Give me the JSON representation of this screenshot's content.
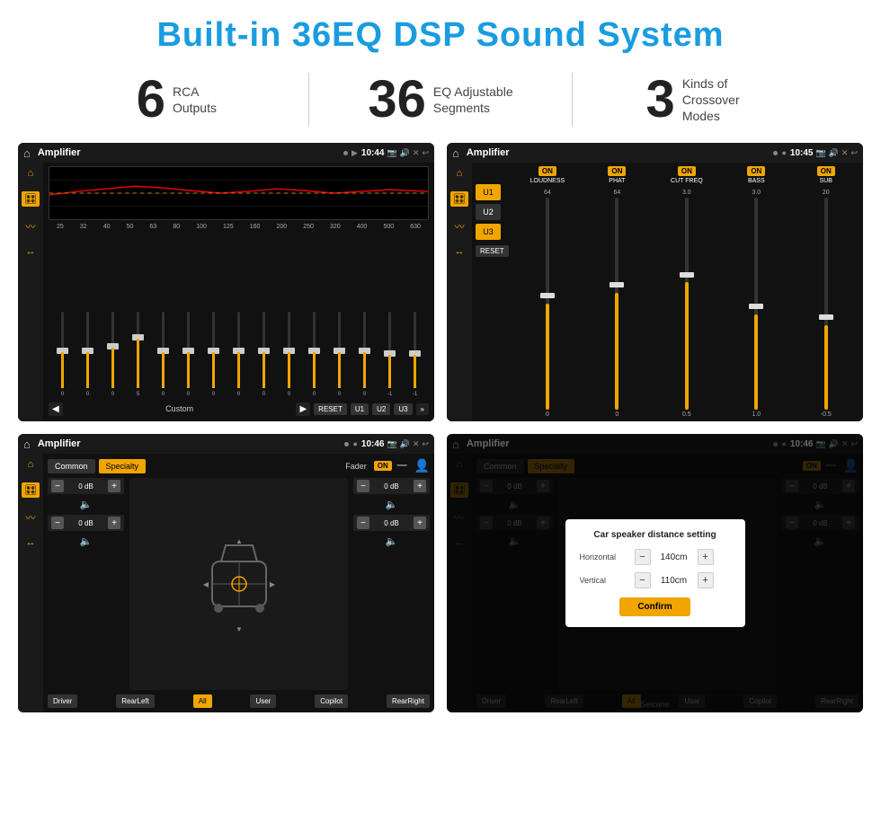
{
  "header": {
    "title": "Built-in 36EQ DSP Sound System"
  },
  "stats": [
    {
      "number": "6",
      "label_line1": "RCA",
      "label_line2": "Outputs"
    },
    {
      "number": "36",
      "label_line1": "EQ Adjustable",
      "label_line2": "Segments"
    },
    {
      "number": "3",
      "label_line1": "Kinds of",
      "label_line2": "Crossover Modes"
    }
  ],
  "screens": [
    {
      "id": "screen1",
      "app_name": "Amplifier",
      "time": "10:44",
      "type": "eq"
    },
    {
      "id": "screen2",
      "app_name": "Amplifier",
      "time": "10:45",
      "type": "crossover"
    },
    {
      "id": "screen3",
      "app_name": "Amplifier",
      "time": "10:46",
      "type": "fader"
    },
    {
      "id": "screen4",
      "app_name": "Amplifier",
      "time": "10:46",
      "type": "distance"
    }
  ],
  "eq": {
    "freq_labels": [
      "25",
      "32",
      "40",
      "50",
      "63",
      "80",
      "100",
      "125",
      "160",
      "200",
      "250",
      "320",
      "400",
      "500",
      "630"
    ],
    "values": [
      "0",
      "0",
      "0",
      "5",
      "0",
      "0",
      "0",
      "0",
      "0",
      "0",
      "0",
      "0",
      "0",
      "-1",
      "-1"
    ],
    "buttons": [
      "RESET",
      "U1",
      "U2",
      "U3"
    ],
    "custom_label": "Custom"
  },
  "crossover": {
    "u_buttons": [
      "U1",
      "U2",
      "U3"
    ],
    "columns": [
      "LOUDNESS",
      "PHAT",
      "CUT FREQ",
      "BASS",
      "SUB"
    ],
    "reset_label": "RESET"
  },
  "fader": {
    "tabs": [
      "Common",
      "Specialty"
    ],
    "fader_label": "Fader",
    "on_label": "ON",
    "db_values": [
      "0 dB",
      "0 dB",
      "0 dB",
      "0 dB"
    ],
    "bottom_buttons": [
      "Driver",
      "RearLeft",
      "All",
      "User",
      "Copilot",
      "RearRight"
    ]
  },
  "distance": {
    "modal_title": "Car speaker distance setting",
    "horizontal_label": "Horizontal",
    "horizontal_value": "140cm",
    "vertical_label": "Vertical",
    "vertical_value": "110cm",
    "confirm_label": "Confirm",
    "db_values": [
      "0 dB",
      "0 dB"
    ],
    "bottom_buttons": [
      "Driver",
      "RearLeft",
      "All",
      "User",
      "Copilot",
      "RearRight"
    ]
  },
  "watermark": "Seicane"
}
